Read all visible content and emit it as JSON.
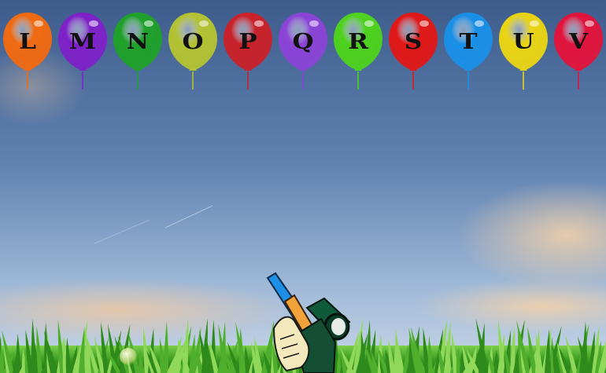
{
  "balloons": [
    {
      "letter": "L",
      "color": "#f06a12"
    },
    {
      "letter": "M",
      "color": "#7e22c8"
    },
    {
      "letter": "N",
      "color": "#1fa02a"
    },
    {
      "letter": "O",
      "color": "#b3c233"
    },
    {
      "letter": "P",
      "color": "#c8222a"
    },
    {
      "letter": "Q",
      "color": "#8a44d6"
    },
    {
      "letter": "R",
      "color": "#4ed21e"
    },
    {
      "letter": "S",
      "color": "#e01818"
    },
    {
      "letter": "T",
      "color": "#1a8fe6"
    },
    {
      "letter": "U",
      "color": "#e9d414"
    },
    {
      "letter": "V",
      "color": "#e0143c"
    }
  ],
  "scene": {
    "sky_top": "#3f5f8f",
    "sky_bottom": "#a9c1dd",
    "grass": "#3fa028",
    "player_tool": "dart-gun-icon"
  }
}
